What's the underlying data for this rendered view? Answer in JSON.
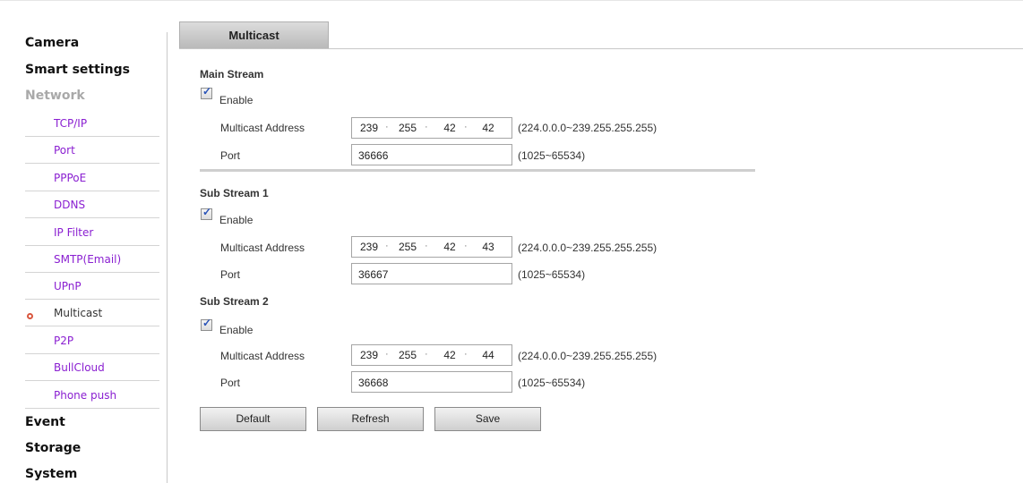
{
  "sidebar": {
    "categories": {
      "camera": "Camera",
      "smart_settings": "Smart settings",
      "network": "Network",
      "event": "Event",
      "storage": "Storage",
      "system": "System"
    },
    "network_items": [
      "TCP/IP",
      "Port",
      "PPPoE",
      "DDNS",
      "IP Filter",
      "SMTP(Email)",
      "UPnP",
      "Multicast",
      "P2P",
      "BullCloud",
      "Phone push"
    ],
    "active_item": "Multicast"
  },
  "tab": {
    "label": "Multicast"
  },
  "streams": [
    {
      "title": "Main Stream",
      "enable_label": "Enable",
      "enabled": true,
      "address_label": "Multicast Address",
      "address": [
        "239",
        "255",
        "42",
        "42"
      ],
      "address_hint": "(224.0.0.0~239.255.255.255)",
      "port_label": "Port",
      "port": "36666",
      "port_hint": "(1025~65534)"
    },
    {
      "title": "Sub Stream 1",
      "enable_label": "Enable",
      "enabled": true,
      "address_label": "Multicast Address",
      "address": [
        "239",
        "255",
        "42",
        "43"
      ],
      "address_hint": "(224.0.0.0~239.255.255.255)",
      "port_label": "Port",
      "port": "36667",
      "port_hint": "(1025~65534)"
    },
    {
      "title": "Sub Stream 2",
      "enable_label": "Enable",
      "enabled": true,
      "address_label": "Multicast Address",
      "address": [
        "239",
        "255",
        "42",
        "44"
      ],
      "address_hint": "(224.0.0.0~239.255.255.255)",
      "port_label": "Port",
      "port": "36668",
      "port_hint": "(1025~65534)"
    }
  ],
  "buttons": {
    "default": "Default",
    "refresh": "Refresh",
    "save": "Save"
  },
  "colors": {
    "link": "#8a1fd1",
    "bullet": "#d9573e",
    "check": "#2a54b8"
  }
}
